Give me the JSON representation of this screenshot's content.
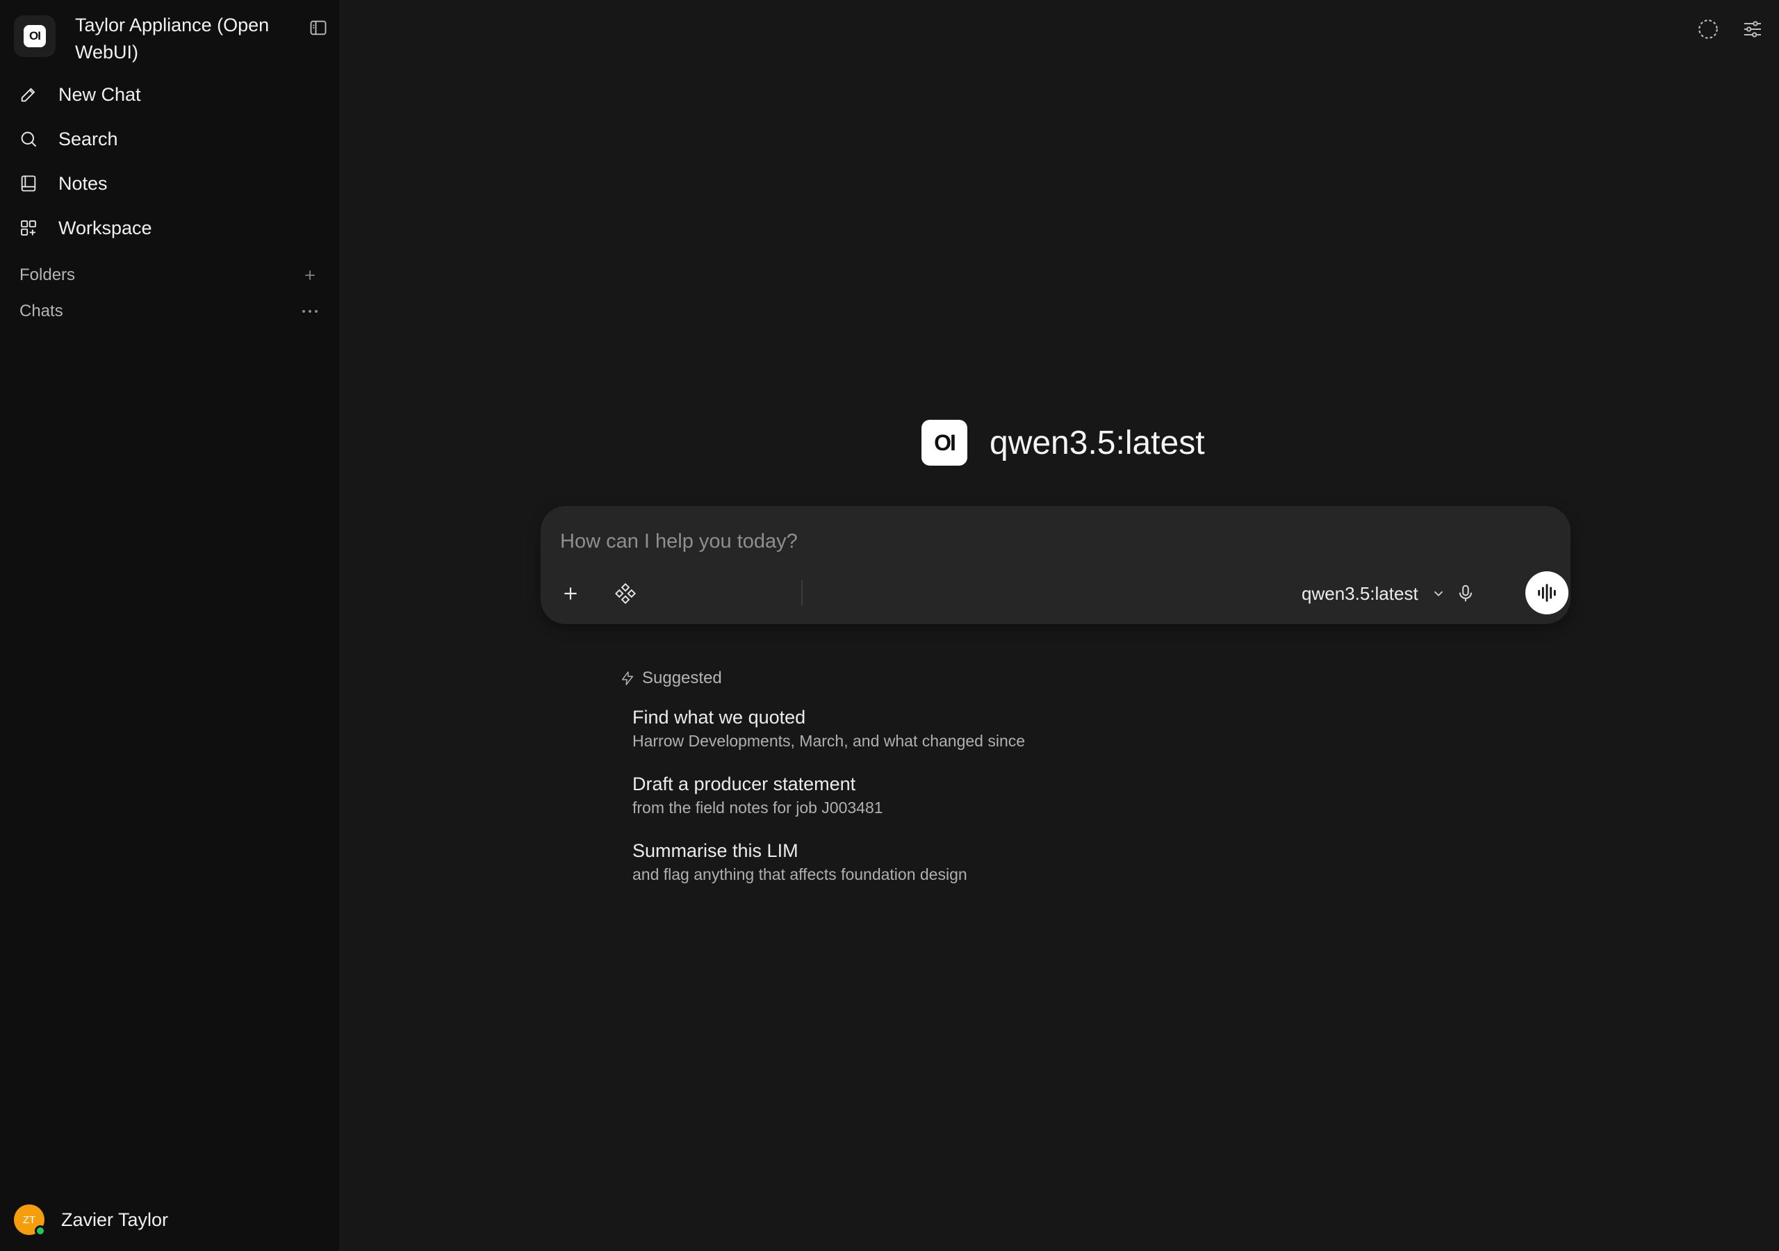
{
  "sidebar": {
    "logo_text": "OI",
    "app_title": "Taylor Appliance (Open WebUI)",
    "nav": [
      {
        "label": "New Chat",
        "icon": "pencil-icon"
      },
      {
        "label": "Search",
        "icon": "search-icon"
      },
      {
        "label": "Notes",
        "icon": "notebook-icon"
      },
      {
        "label": "Workspace",
        "icon": "grid-plus-icon"
      }
    ],
    "folders_label": "Folders",
    "chats_label": "Chats",
    "user": {
      "initials": "ZT",
      "name": "Zavier Taylor",
      "status_color": "#22c55e"
    }
  },
  "main": {
    "model_logo_text": "OI",
    "model_title": "qwen3.5:latest",
    "composer": {
      "placeholder": "How can I help you today?",
      "value": "",
      "model_selector_label": "qwen3.5:latest"
    },
    "suggested_label": "Suggested",
    "suggestions": [
      {
        "title": "Find what we quoted",
        "subtitle": "Harrow Developments, March, and what changed since"
      },
      {
        "title": "Draft a producer statement",
        "subtitle": "from the field notes for job J003481"
      },
      {
        "title": "Summarise this LIM",
        "subtitle": "and flag anything that affects foundation design"
      }
    ]
  },
  "colors": {
    "sidebar_bg": "#0f0f0f",
    "main_bg": "#171717",
    "composer_bg": "#262626",
    "avatar": "#f59e0b"
  }
}
